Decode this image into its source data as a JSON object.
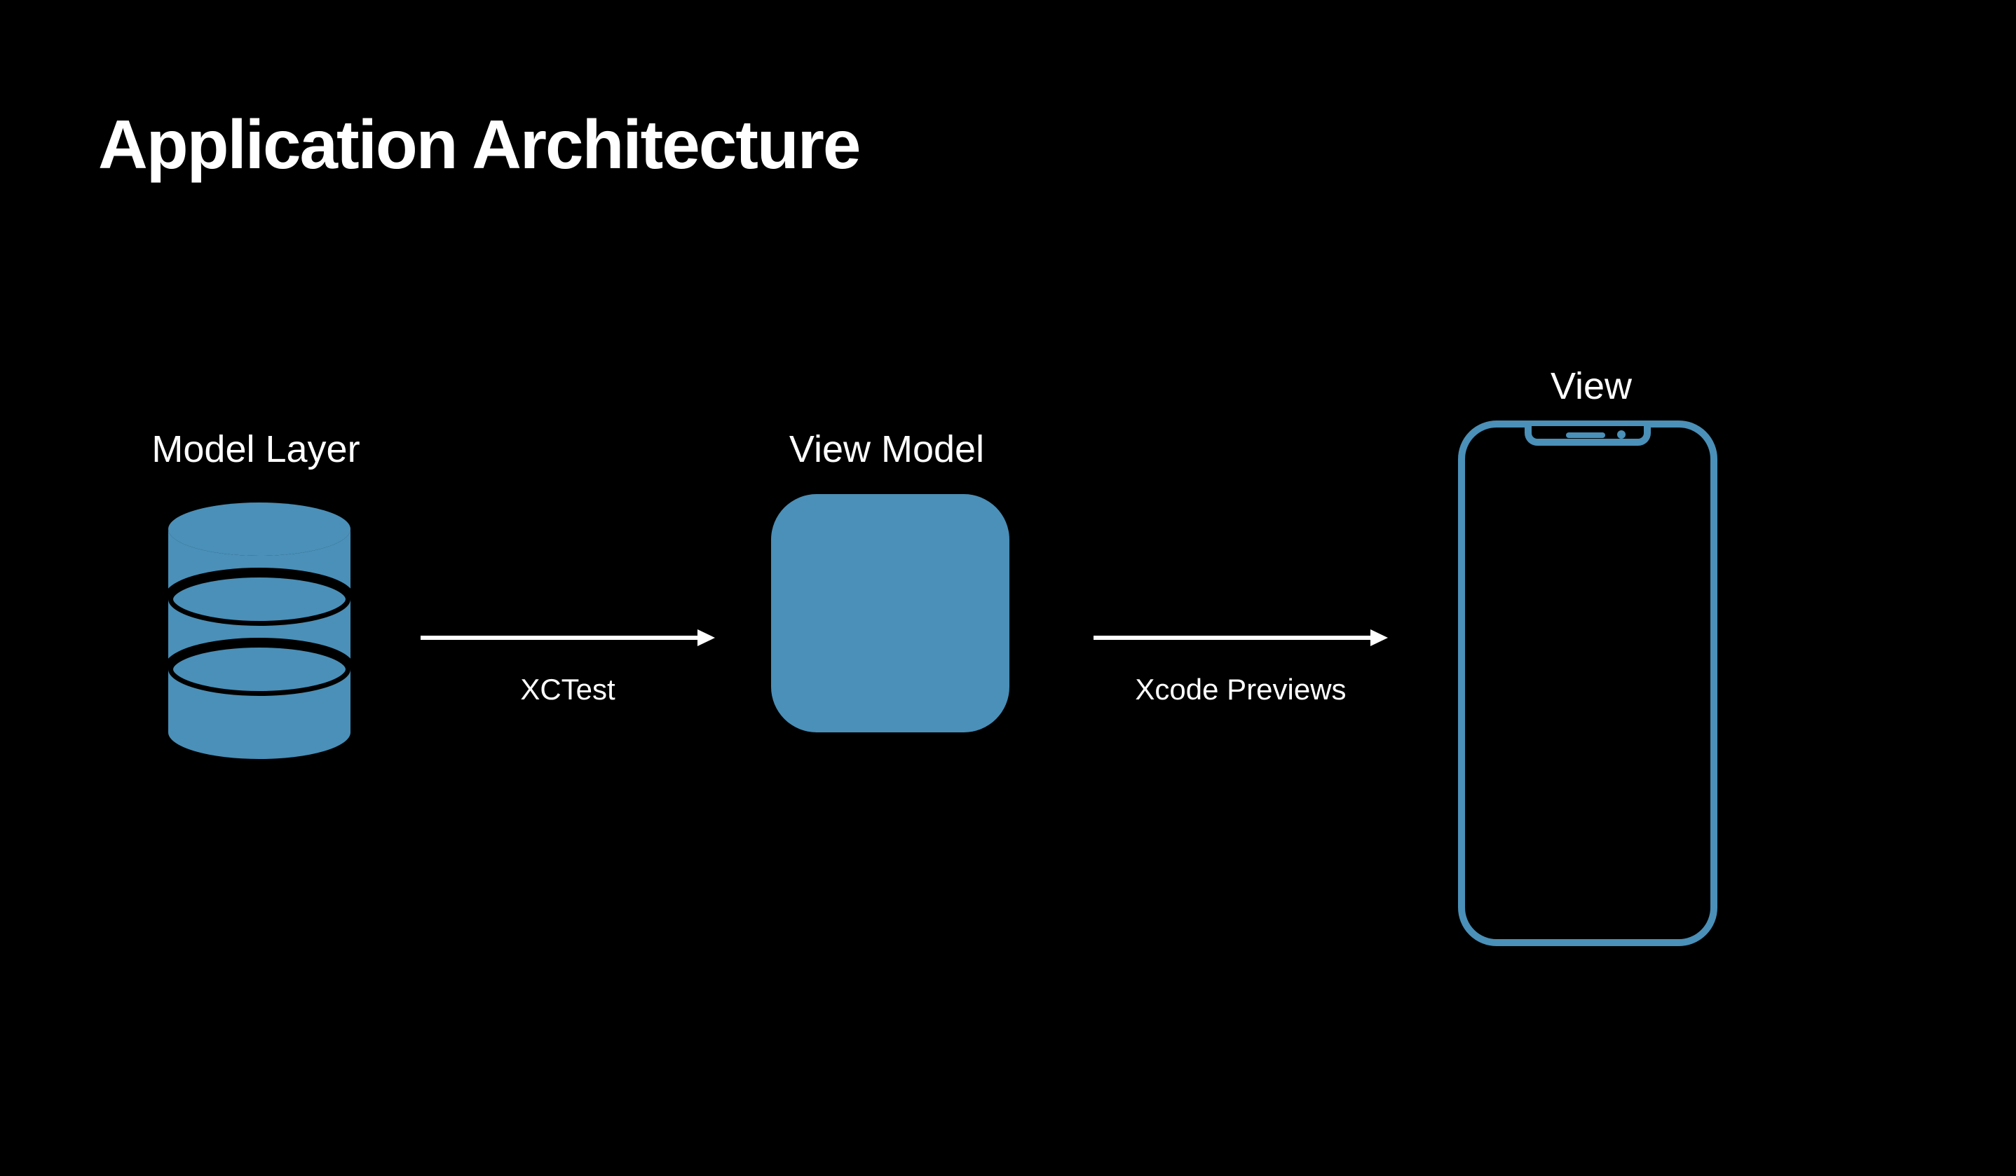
{
  "title": "Application Architecture",
  "nodes": {
    "model": {
      "label": "Model Layer"
    },
    "viewmodel": {
      "label": "View Model"
    },
    "view": {
      "label": "View"
    }
  },
  "arrows": {
    "modelToViewmodel": {
      "label": "XCTest"
    },
    "viewmodelToView": {
      "label": "Xcode Previews"
    }
  },
  "colors": {
    "accent": "#4a90b8",
    "background": "#000000",
    "text": "#ffffff"
  }
}
